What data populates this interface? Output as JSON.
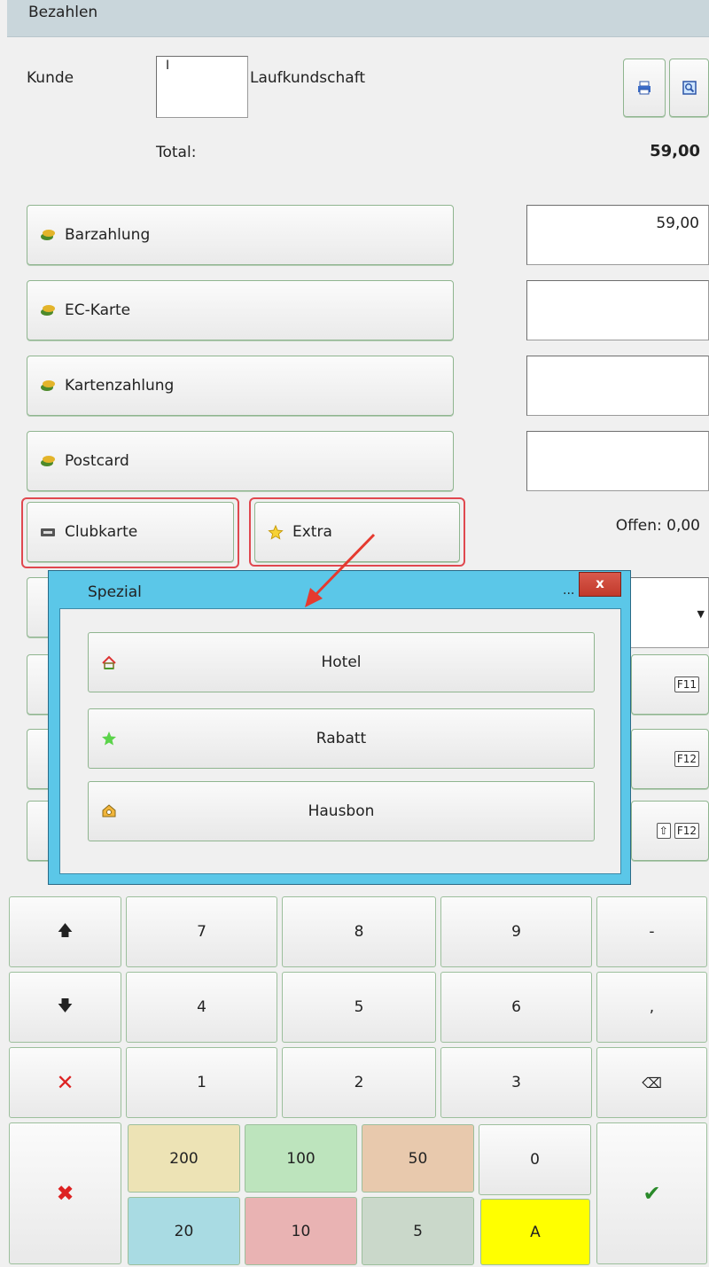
{
  "window": {
    "title": "Bezahlen"
  },
  "customer": {
    "label": "Kunde",
    "input_value": "I",
    "name": "Laufkundschaft"
  },
  "total": {
    "label": "Total:",
    "value": "59,00"
  },
  "payments": [
    {
      "label": "Barzahlung",
      "amount": "59,00"
    },
    {
      "label": "EC-Karte",
      "amount": ""
    },
    {
      "label": "Kartenzahlung",
      "amount": ""
    },
    {
      "label": "Postcard",
      "amount": ""
    }
  ],
  "extra_buttons": {
    "clubcard": "Clubkarte",
    "extra": "Extra"
  },
  "open": {
    "label": "Offen: 0,00"
  },
  "shortcuts": {
    "f11": "F11",
    "f12": "F12",
    "shift_f12": "F12"
  },
  "dialog": {
    "title": "Spezial",
    "dots": "...",
    "close": "x",
    "options": [
      {
        "label": "Hotel",
        "icon": "house-icon"
      },
      {
        "label": "Rabatt",
        "icon": "star-icon"
      },
      {
        "label": "Hausbon",
        "icon": "voucher-icon"
      }
    ]
  },
  "keypad": {
    "row1": [
      "7",
      "8",
      "9",
      "-"
    ],
    "row2": [
      "4",
      "5",
      "6",
      ","
    ],
    "row3": [
      "1",
      "2",
      "3"
    ],
    "zero": "0",
    "notes_top": [
      "200",
      "100",
      "50"
    ],
    "notes_bottom": [
      "20",
      "10",
      "5",
      "A"
    ]
  },
  "colors": {
    "dialog_frame": "#5bc7e8",
    "highlight": "#e0484f",
    "button_border": "#8fb58f",
    "note_200": "#ede3b5",
    "note_100": "#bde4bd",
    "note_50": "#e8c9ad",
    "note_20": "#a9dbe3",
    "note_10": "#e9b3b3",
    "note_5": "#cad8ca",
    "note_a": "#ffff00"
  }
}
